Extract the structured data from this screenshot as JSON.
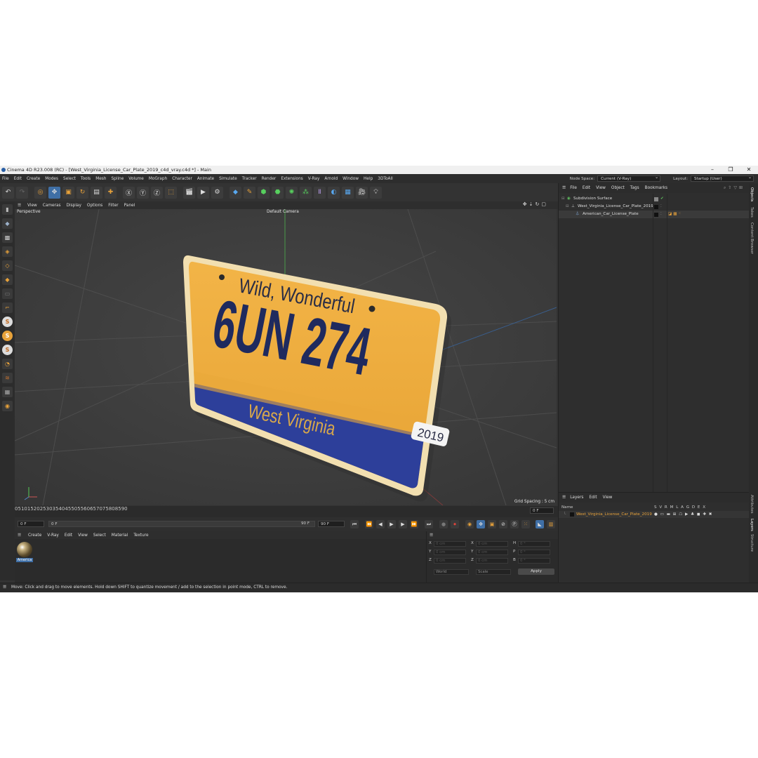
{
  "window": {
    "title": "Cinema 4D R23.008 (RC) - [West_Virginia_License_Car_Plate_2019_c4d_vray.c4d *] - Main",
    "min": "–",
    "max": "❐",
    "close": "✕"
  },
  "menu": [
    "File",
    "Edit",
    "Create",
    "Modes",
    "Select",
    "Tools",
    "Mesh",
    "Spline",
    "Volume",
    "MoGraph",
    "Character",
    "Animate",
    "Simulate",
    "Tracker",
    "Render",
    "Extensions",
    "V-Ray",
    "Arnold",
    "Window",
    "Help",
    "3DToAll"
  ],
  "node_space": {
    "label": "Node Space:",
    "value": "Current (V-Ray)"
  },
  "layout": {
    "label": "Layout:",
    "value": "Startup (User)"
  },
  "viewport": {
    "menu": [
      "View",
      "Cameras",
      "Display",
      "Options",
      "Filter",
      "Panel"
    ],
    "projection": "Perspective",
    "camera": "Default Camera",
    "grid_spacing": "Grid Spacing : 5 cm",
    "plate": {
      "line1": "Wild, Wonderful",
      "number": "6UN 274",
      "state": "West Virginia",
      "year": "2019"
    }
  },
  "timeline": {
    "ticks": [
      "0",
      "5",
      "10",
      "15",
      "20",
      "25",
      "30",
      "35",
      "40",
      "45",
      "50",
      "55",
      "60",
      "65",
      "70",
      "75",
      "80",
      "85",
      "90"
    ],
    "current": "0 F"
  },
  "transport": {
    "start": "0 F",
    "range_start": "0 F",
    "range_end": "90 F",
    "end": "90 F",
    "current": "0 F"
  },
  "material_panel": {
    "menu": [
      "Create",
      "V-Ray",
      "Edit",
      "View",
      "Select",
      "Material",
      "Texture"
    ],
    "material_name": "America"
  },
  "coords": {
    "rows": [
      {
        "a": "X",
        "av": "0 cm",
        "b": "X",
        "bv": "0 cm",
        "c": "H",
        "cv": "0 °"
      },
      {
        "a": "Y",
        "av": "0 cm",
        "b": "Y",
        "bv": "0 cm",
        "c": "P",
        "cv": "0 °"
      },
      {
        "a": "Z",
        "av": "0 cm",
        "b": "Z",
        "bv": "0 cm",
        "c": "B",
        "cv": "0 °"
      }
    ],
    "mode1": "World",
    "mode2": "Scale",
    "apply": "Apply"
  },
  "status": "Move: Click and drag to move elements. Hold down SHIFT to quantize movement / add to the selection in point mode, CTRL to remove.",
  "objects": {
    "menu": [
      "File",
      "Edit",
      "View",
      "Object",
      "Tags",
      "Bookmarks"
    ],
    "items": [
      {
        "name": "Subdivision Surface"
      },
      {
        "name": "West_Virginia_License_Car_Plate_2019"
      },
      {
        "name": "American_Car_License_Plate"
      }
    ]
  },
  "layers": {
    "menu": [
      "Layers",
      "Edit",
      "View"
    ],
    "header_name": "Name",
    "header_flags": "S V R M L A G D E X",
    "row": "West_Virginia_License_Car_Plate_2019"
  },
  "right_tabs": [
    "Objects",
    "Takes",
    "Content Browser",
    "Attributes",
    "Layers",
    "Structure"
  ]
}
